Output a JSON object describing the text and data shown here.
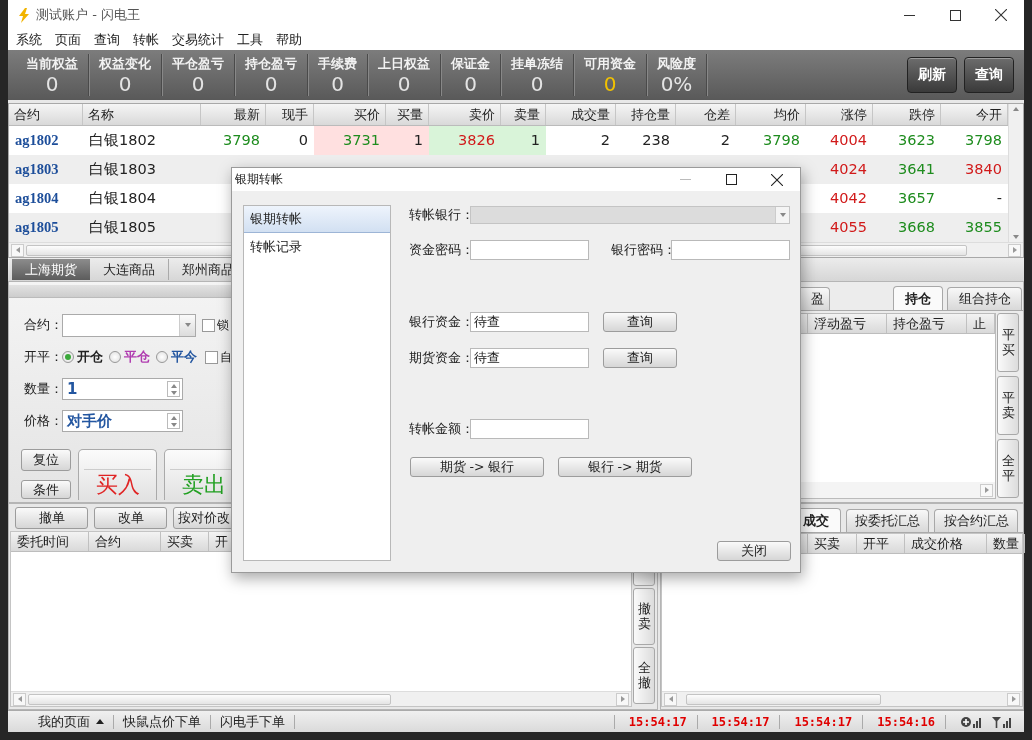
{
  "window": {
    "title": "测试账户 - 闪电王"
  },
  "menu": [
    "系统",
    "页面",
    "查询",
    "转帐",
    "交易统计",
    "工具",
    "帮助"
  ],
  "account_stats": [
    {
      "label": "当前权益",
      "value": "0",
      "highlight": false
    },
    {
      "label": "权益变化",
      "value": "0",
      "highlight": false
    },
    {
      "label": "平仓盈亏",
      "value": "0",
      "highlight": false
    },
    {
      "label": "持仓盈亏",
      "value": "0",
      "highlight": false
    },
    {
      "label": "手续费",
      "value": "0",
      "highlight": false
    },
    {
      "label": "上日权益",
      "value": "0",
      "highlight": false
    },
    {
      "label": "保证金",
      "value": "0",
      "highlight": false
    },
    {
      "label": "挂单冻结",
      "value": "0",
      "highlight": false
    },
    {
      "label": "可用资金",
      "value": "0",
      "highlight": true
    },
    {
      "label": "风险度",
      "value": "0%",
      "highlight": false
    }
  ],
  "toolbar_buttons": [
    "刷新",
    "查询"
  ],
  "quotes": {
    "columns": [
      {
        "label": "合约",
        "kind": "text"
      },
      {
        "label": "名称",
        "kind": "text"
      },
      {
        "label": "最新",
        "kind": "number"
      },
      {
        "label": "现手",
        "kind": "number"
      },
      {
        "label": "买价",
        "kind": "bid"
      },
      {
        "label": "买量",
        "kind": "bid"
      },
      {
        "label": "卖价",
        "kind": "ask"
      },
      {
        "label": "卖量",
        "kind": "ask"
      },
      {
        "label": "成交量",
        "kind": "number"
      },
      {
        "label": "持仓量",
        "kind": "number"
      },
      {
        "label": "仓差",
        "kind": "number"
      },
      {
        "label": "均价",
        "kind": "number"
      },
      {
        "label": "涨停",
        "kind": "number"
      },
      {
        "label": "跌停",
        "kind": "number"
      },
      {
        "label": "今开",
        "kind": "number"
      }
    ],
    "rows": [
      {
        "cells": [
          {
            "text": "ag1802"
          },
          {
            "text": "白银1802"
          },
          {
            "text": "3798",
            "color": "#1e8c1e"
          },
          {
            "text": "0"
          },
          {
            "text": "3731",
            "color": "#1e8c1e"
          },
          {
            "text": "1"
          },
          {
            "text": "3826",
            "color": "#d11a1a"
          },
          {
            "text": "1"
          },
          {
            "text": "2"
          },
          {
            "text": "238"
          },
          {
            "text": "2"
          },
          {
            "text": "3798",
            "color": "#1e8c1e"
          },
          {
            "text": "4004",
            "color": "#d11a1a"
          },
          {
            "text": "3623",
            "color": "#1e8c1e"
          },
          {
            "text": "3798",
            "color": "#1e8c1e"
          }
        ]
      },
      {
        "cells": [
          {
            "text": "ag1803"
          },
          {
            "text": "白银1803"
          },
          {
            "text": ""
          },
          {
            "text": ""
          },
          {
            "text": ""
          },
          {
            "text": ""
          },
          {
            "text": ""
          },
          {
            "text": ""
          },
          {
            "text": ""
          },
          {
            "text": ""
          },
          {
            "text": ""
          },
          {
            "text": ""
          },
          {
            "text": "4024",
            "color": "#d11a1a"
          },
          {
            "text": "3641",
            "color": "#1e8c1e"
          },
          {
            "text": "3840",
            "color": "#d11a1a"
          }
        ]
      },
      {
        "cells": [
          {
            "text": "ag1804"
          },
          {
            "text": "白银1804"
          },
          {
            "text": ""
          },
          {
            "text": ""
          },
          {
            "text": ""
          },
          {
            "text": ""
          },
          {
            "text": ""
          },
          {
            "text": ""
          },
          {
            "text": ""
          },
          {
            "text": ""
          },
          {
            "text": ""
          },
          {
            "text": ""
          },
          {
            "text": "4042",
            "color": "#d11a1a"
          },
          {
            "text": "3657",
            "color": "#1e8c1e"
          },
          {
            "text": "-"
          }
        ]
      },
      {
        "cells": [
          {
            "text": "ag1805"
          },
          {
            "text": "白银1805"
          },
          {
            "text": ""
          },
          {
            "text": ""
          },
          {
            "text": ""
          },
          {
            "text": ""
          },
          {
            "text": ""
          },
          {
            "text": ""
          },
          {
            "text": ""
          },
          {
            "text": ""
          },
          {
            "text": ""
          },
          {
            "text": ""
          },
          {
            "text": "4055",
            "color": "#d11a1a"
          },
          {
            "text": "3668",
            "color": "#1e8c1e"
          },
          {
            "text": "3855",
            "color": "#1e8c1e"
          }
        ]
      }
    ]
  },
  "exchange_tabs": [
    {
      "label": "上海期货",
      "selected": true
    },
    {
      "label": "大连商品",
      "selected": false
    },
    {
      "label": "郑州商品",
      "selected": false
    }
  ],
  "order_form": {
    "contract": {
      "label": "合约："
    },
    "lock": {
      "label": "锁",
      "checked": false
    },
    "open_close": {
      "label": "开平：",
      "options": [
        {
          "label": "开仓",
          "selected": true,
          "color": "#222222"
        },
        {
          "label": "平仓",
          "selected": false,
          "color": "#b03cb0"
        },
        {
          "label": "平今",
          "selected": false,
          "color": "#2356a0"
        }
      ]
    },
    "auto": {
      "label": "自",
      "checked": false
    },
    "quantity": {
      "label": "数量：",
      "value": "1"
    },
    "price": {
      "label": "价格：",
      "value": "对手价"
    },
    "reset_button": "复位",
    "condition_button": "条件",
    "buy_button": "买入",
    "sell_button": "卖出"
  },
  "positions": {
    "tabs": [
      {
        "label": "盈",
        "selected": false
      },
      {
        "label": "持仓",
        "selected": true
      },
      {
        "label": "组合持仓",
        "selected": false
      }
    ],
    "columns": [
      "浮动盈亏",
      "持仓盈亏",
      "止"
    ],
    "side_buttons": [
      "平买",
      "平卖",
      "全平"
    ]
  },
  "orders": {
    "buttons": [
      "撤单",
      "改单",
      "按对价改"
    ],
    "columns": [
      "委托时间",
      "合约",
      "买卖",
      "开"
    ],
    "side_buttons": [
      "撤卖",
      "全撤"
    ]
  },
  "trades": {
    "tabs": [
      {
        "label": "成交",
        "selected": true
      },
      {
        "label": "按委托汇总",
        "selected": false
      },
      {
        "label": "按合约汇总",
        "selected": false
      }
    ],
    "columns": [
      "买卖",
      "开平",
      "成交价格",
      "数量"
    ]
  },
  "status_bar": {
    "items": [
      "我的页面",
      "快鼠点价下单",
      "闪电手下单"
    ],
    "times": [
      "15:54:17",
      "15:54:17",
      "15:54:17",
      "15:54:16"
    ]
  },
  "dialog": {
    "title": "银期转帐",
    "nav": [
      {
        "label": "银期转帐",
        "selected": true
      },
      {
        "label": "转帐记录",
        "selected": false
      }
    ],
    "bank": {
      "label": "转帐银行：",
      "disabled": true
    },
    "fund_password": {
      "label": "资金密码："
    },
    "bank_password": {
      "label": "银行密码："
    },
    "bank_balance": {
      "label": "银行资金：",
      "value": "待查",
      "button": "查询"
    },
    "futures_balance": {
      "label": "期货资金：",
      "value": "待查",
      "button": "查询"
    },
    "amount": {
      "label": "转帐金额："
    },
    "transfer_buttons": [
      "期货 -> 银行",
      "银行 -> 期货"
    ],
    "close_button": "关闭"
  }
}
